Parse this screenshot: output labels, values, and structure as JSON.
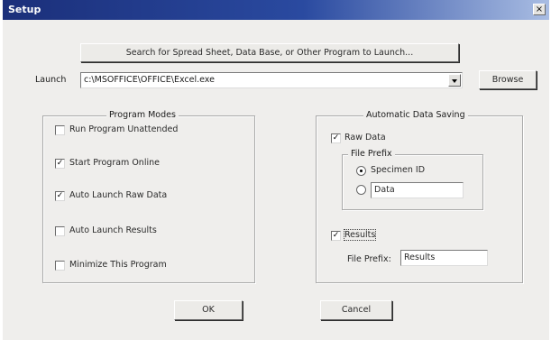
{
  "window": {
    "title": "Setup",
    "close_glyph": "×"
  },
  "search_button": {
    "label": "Search for Spread Sheet, Data Base, or Other Program to Launch..."
  },
  "launch": {
    "label": "Launch",
    "value": "c:\\MSOFFICE\\OFFICE\\Excel.exe"
  },
  "browse_button": {
    "label": "Browse"
  },
  "program_modes": {
    "title": "Program Modes",
    "options": [
      {
        "label": "Run Program Unattended",
        "checked": false
      },
      {
        "label": "Start Program Online",
        "checked": true
      },
      {
        "label": "Auto Launch Raw Data",
        "checked": true
      },
      {
        "label": "Auto Launch Results",
        "checked": false
      },
      {
        "label": "Minimize This Program",
        "checked": false
      }
    ]
  },
  "auto_saving": {
    "title": "Automatic Data Saving",
    "raw_data": {
      "label": "Raw Data",
      "checked": true
    },
    "file_prefix_group": {
      "title": "File Prefix",
      "specimen_id": {
        "label": "Specimen ID",
        "selected": true
      },
      "custom": {
        "selected": false,
        "value": "Data"
      }
    },
    "results": {
      "label": "Results",
      "checked": true
    },
    "results_prefix": {
      "label": "File Prefix:",
      "value": "Results"
    }
  },
  "ok_button": {
    "label": "OK"
  },
  "cancel_button": {
    "label": "Cancel"
  },
  "check_glyph": "✓"
}
